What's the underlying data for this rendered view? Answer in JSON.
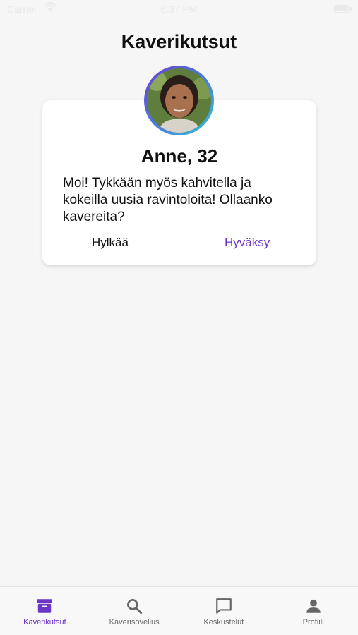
{
  "status_bar": {
    "carrier": "Carrier",
    "time": "6:37 PM"
  },
  "header": {
    "title": "Kaverikutsut"
  },
  "invite_card": {
    "name_age": "Anne, 32",
    "message": "Moi! Tykkään myös kahvitella ja kokeilla uusia ravintoloita! Ollaanko kavereita?",
    "decline_label": "Hylkää",
    "accept_label": "Hyväksy"
  },
  "tab_bar": {
    "tabs": [
      {
        "label": "Kaverikutsut",
        "icon": "archive-icon",
        "active": true
      },
      {
        "label": "Kaverisovellus",
        "icon": "search-icon",
        "active": false
      },
      {
        "label": "Keskustelut",
        "icon": "chat-icon",
        "active": false
      },
      {
        "label": "Profiili",
        "icon": "person-icon",
        "active": false
      }
    ]
  },
  "colors": {
    "accent": "#6b35c8",
    "background": "#f6f6f6",
    "inactive_tab": "#666666"
  }
}
